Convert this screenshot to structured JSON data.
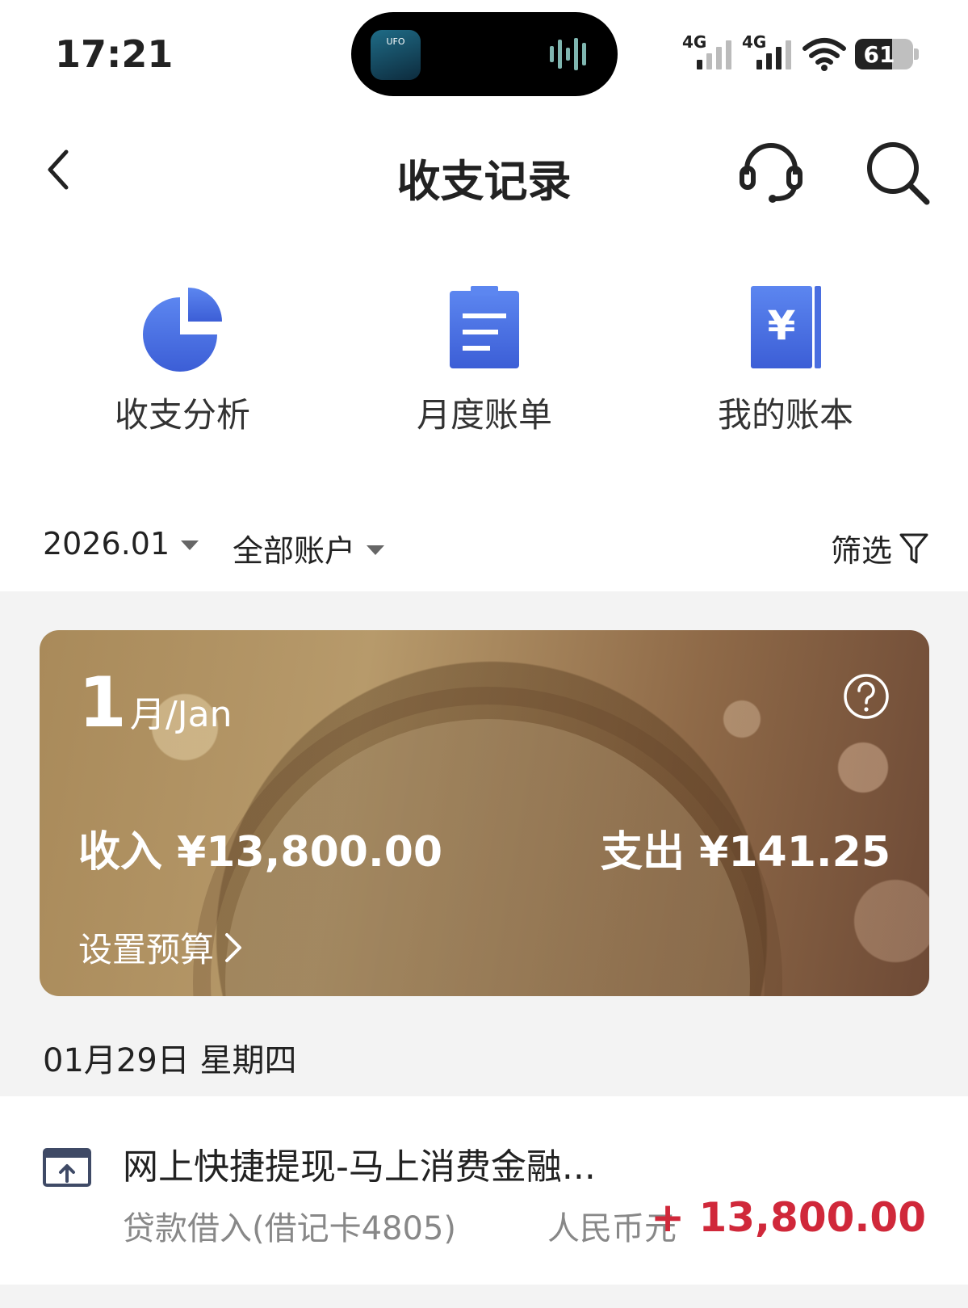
{
  "status_bar": {
    "time": "17:21",
    "island_app_text": "UFO",
    "signal1_label": "4G",
    "signal2_label": "4G",
    "battery": "61"
  },
  "header": {
    "title": "收支记录",
    "back_icon": "chevron-left-icon",
    "service_icon": "headset-icon",
    "search_icon": "search-icon"
  },
  "quick_actions": [
    {
      "label": "收支分析",
      "icon": "pie-chart-icon"
    },
    {
      "label": "月度账单",
      "icon": "clipboard-icon"
    },
    {
      "label": "我的账本",
      "icon": "ledger-yuan-icon"
    }
  ],
  "filters": {
    "month": "2026.01",
    "account": "全部账户",
    "filter_label": "筛选"
  },
  "summary": {
    "month_number": "1",
    "month_suffix": "月/Jan",
    "income": "收入 ¥13,800.00",
    "expense": "支出 ¥141.25",
    "budget_link": "设置预算"
  },
  "date_group": "01月29日 星期四",
  "transactions": [
    {
      "name": "网上快捷提现-马上消费金融...",
      "sub": "贷款借入(借记卡4805)",
      "currency": "人民币元",
      "amount": "+ 13,800.00"
    }
  ],
  "colors": {
    "accent_blue": "#4a6ee0",
    "amount_red": "#d0283a"
  }
}
